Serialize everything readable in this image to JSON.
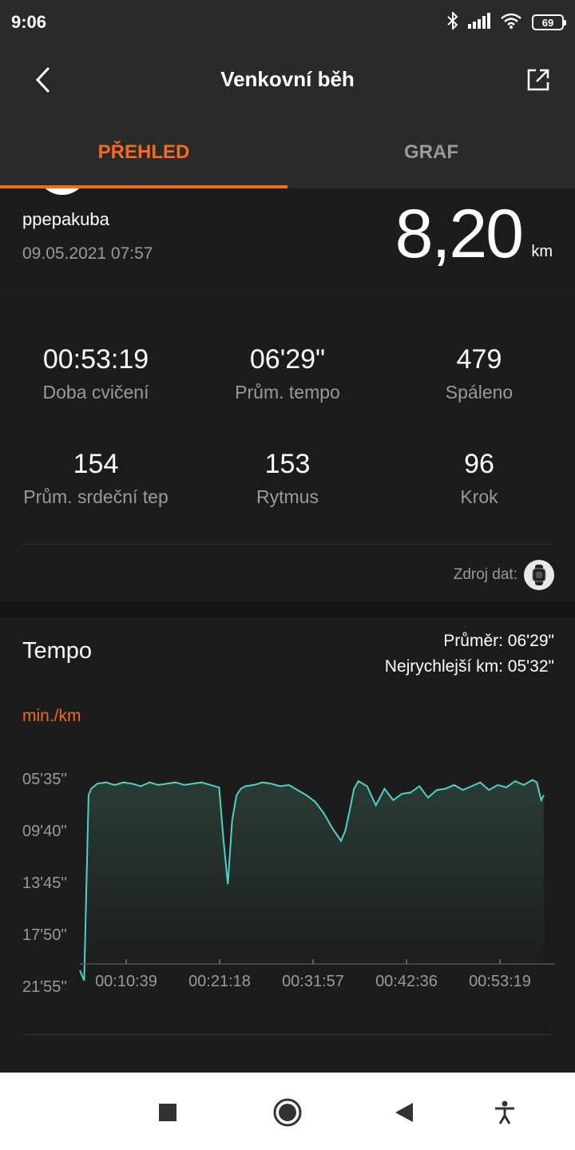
{
  "status_bar": {
    "time": "9:06",
    "battery": "69"
  },
  "header": {
    "title": "Venkovní běh"
  },
  "tabs": [
    {
      "label": "PŘEHLED",
      "active": true
    },
    {
      "label": "GRAF",
      "active": false
    }
  ],
  "summary": {
    "username": "ppepakuba",
    "datetime": "09.05.2021 07:57",
    "distance": "8,20",
    "distance_unit": "km"
  },
  "stats": [
    {
      "value": "00:53:19",
      "label": "Doba cvičení"
    },
    {
      "value": "06'29\"",
      "label": "Prům. tempo"
    },
    {
      "value": "479",
      "label": "Spáleno"
    },
    {
      "value": "154",
      "label": "Prům. srdeční tep"
    },
    {
      "value": "153",
      "label": "Rytmus"
    },
    {
      "value": "96",
      "label": "Krok"
    }
  ],
  "source": {
    "label": "Zdroj dat:",
    "icon": "watch-icon"
  },
  "tempo": {
    "title": "Tempo",
    "average": "Průměr: 06'29\"",
    "fastest": "Nejrychlejší km: 05'32\"",
    "unit": "min./km"
  },
  "colors": {
    "accent": "#f26b21",
    "line": "#4fd1c5",
    "background": "#151515",
    "card": "#1c1c1c"
  },
  "chart_data": {
    "type": "area",
    "y_tick_labels": [
      "05'35''",
      "09'40''",
      "13'45''",
      "17'50''",
      "21'55''"
    ],
    "x_tick_labels": [
      "00:10:39",
      "00:21:18",
      "00:31:57",
      "00:42:36",
      "00:53:19"
    ],
    "x_unit": "minutes",
    "y_unit": "min/km pace (inverted axis, faster at top)",
    "x": [
      0,
      0.5,
      1,
      1.3,
      2,
      3,
      4,
      5,
      6,
      7,
      8,
      9,
      10,
      11,
      12,
      13,
      14,
      15,
      16,
      16.5,
      17,
      17.5,
      18,
      18.5,
      19,
      20,
      21,
      22,
      23,
      24,
      25,
      26,
      27,
      28,
      29,
      30,
      30.5,
      31,
      31.5,
      32,
      33,
      34,
      35,
      36,
      37,
      38,
      39,
      40,
      41,
      42,
      43,
      44,
      45,
      46,
      47,
      48,
      49,
      50,
      51,
      52,
      52.5,
      53,
      53.3
    ],
    "y": [
      20.8,
      21.6,
      7.0,
      6.5,
      6.1,
      6.0,
      6.2,
      6.0,
      6.1,
      6.3,
      6.0,
      6.2,
      6.1,
      6.0,
      6.2,
      6.1,
      6.0,
      6.2,
      6.4,
      10.5,
      14.0,
      9.0,
      7.0,
      6.5,
      6.3,
      6.2,
      6.0,
      6.1,
      6.3,
      6.2,
      6.6,
      7.0,
      7.5,
      8.4,
      9.6,
      10.6,
      9.8,
      8.2,
      6.5,
      5.9,
      6.3,
      7.8,
      6.5,
      7.4,
      6.9,
      6.8,
      6.3,
      7.2,
      6.6,
      6.5,
      6.2,
      6.6,
      6.3,
      6.0,
      6.6,
      6.2,
      6.4,
      5.9,
      6.2,
      5.8,
      6.0,
      7.4,
      7.0
    ],
    "ylim": [
      5.58,
      21.92
    ],
    "xlim": [
      0,
      54.5
    ]
  }
}
